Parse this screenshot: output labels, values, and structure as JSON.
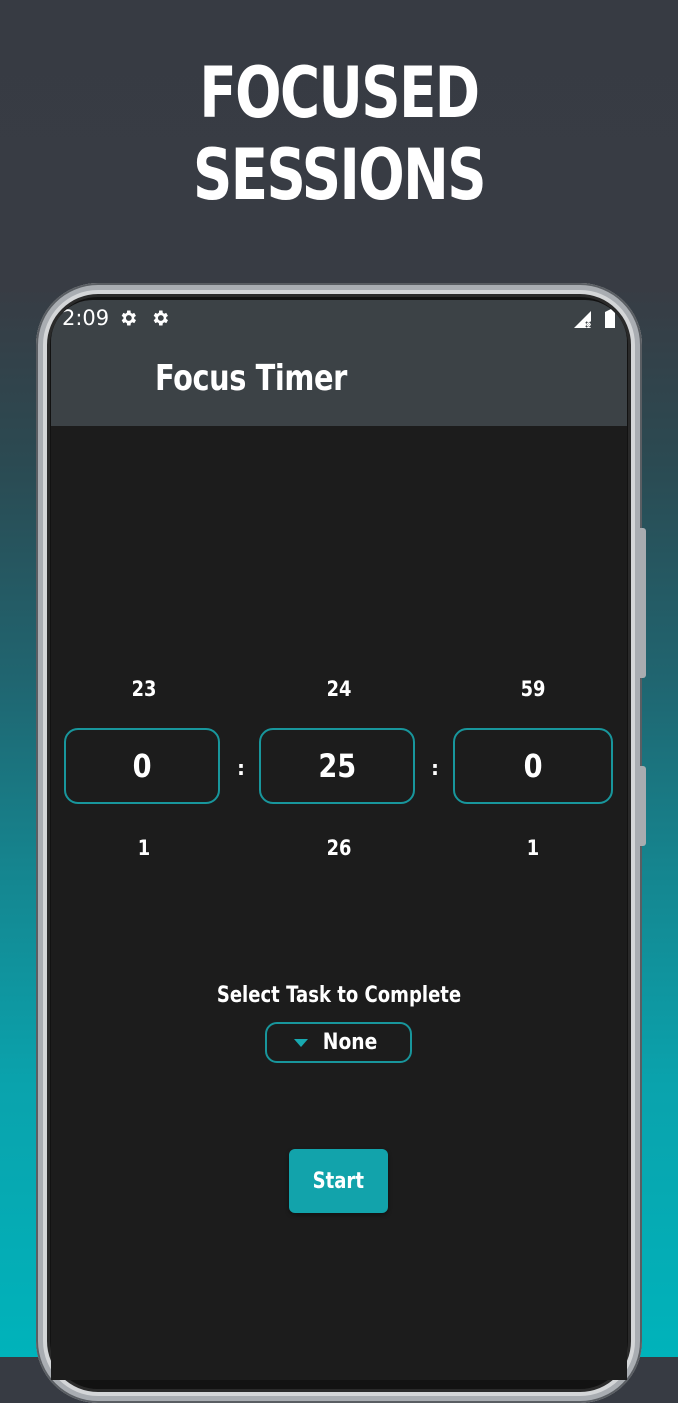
{
  "headline": "FOCUSED SESSIONS",
  "status_bar": {
    "time": "2:09",
    "icons": [
      "gear-icon",
      "gear-icon",
      "signal-icon",
      "battery-icon"
    ]
  },
  "app_bar": {
    "title": "Focus Timer"
  },
  "timer": {
    "hours": {
      "prev": "23",
      "value": "0",
      "next": "1"
    },
    "minutes": {
      "prev": "24",
      "value": "25",
      "next": "26"
    },
    "seconds": {
      "prev": "59",
      "value": "0",
      "next": "1"
    },
    "separator": ":"
  },
  "task": {
    "label": "Select Task to Complete",
    "selected": "None"
  },
  "start_button": {
    "label": "Start"
  },
  "colors": {
    "accent": "#18969c",
    "button": "#12a3ab",
    "screen_bg": "#1c1c1c",
    "appbar_bg": "#3c4246"
  }
}
